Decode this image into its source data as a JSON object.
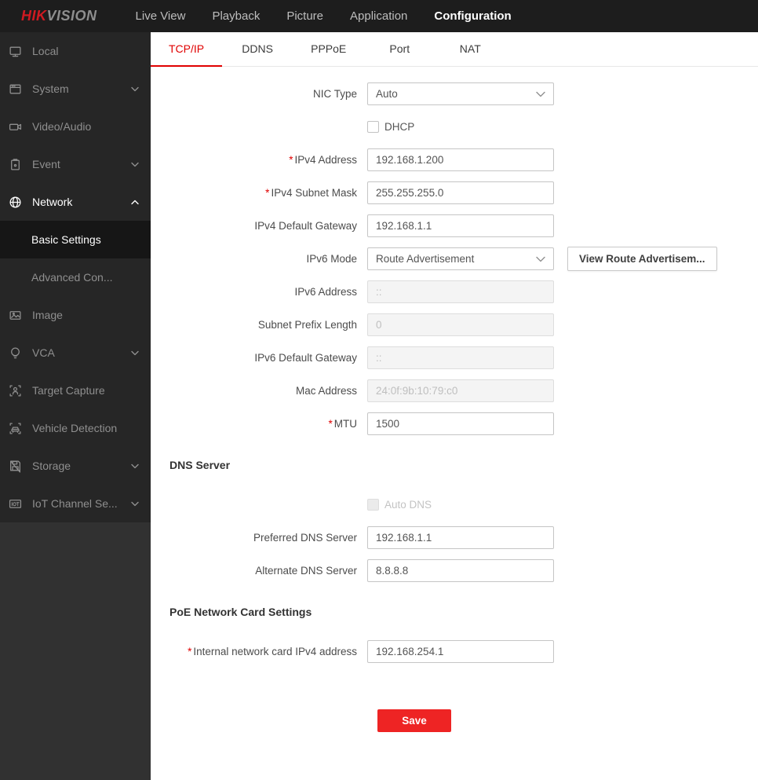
{
  "required_marker": "*",
  "topbar": {
    "logo": {
      "hik": "HIK",
      "vision": "VISION"
    },
    "nav": [
      {
        "label": "Live View"
      },
      {
        "label": "Playback"
      },
      {
        "label": "Picture"
      },
      {
        "label": "Application"
      },
      {
        "label": "Configuration"
      }
    ]
  },
  "sidebar": {
    "items": [
      {
        "label": "Local"
      },
      {
        "label": "System"
      },
      {
        "label": "Video/Audio"
      },
      {
        "label": "Event"
      },
      {
        "label": "Network"
      },
      {
        "label": "Basic Settings"
      },
      {
        "label": "Advanced Con..."
      },
      {
        "label": "Image"
      },
      {
        "label": "VCA"
      },
      {
        "label": "Target Capture"
      },
      {
        "label": "Vehicle Detection"
      },
      {
        "label": "Storage"
      },
      {
        "label": "IoT Channel Se..."
      }
    ]
  },
  "tabs": [
    {
      "label": "TCP/IP"
    },
    {
      "label": "DDNS"
    },
    {
      "label": "PPPoE"
    },
    {
      "label": "Port"
    },
    {
      "label": "NAT"
    }
  ],
  "form": {
    "nic_type": {
      "label": "NIC Type",
      "value": "Auto"
    },
    "dhcp": {
      "label": "DHCP",
      "checked": false
    },
    "ipv4_address": {
      "label": "IPv4 Address",
      "value": "192.168.1.200"
    },
    "ipv4_subnet": {
      "label": "IPv4 Subnet Mask",
      "value": "255.255.255.0"
    },
    "ipv4_gateway": {
      "label": "IPv4 Default Gateway",
      "value": "192.168.1.1"
    },
    "ipv6_mode": {
      "label": "IPv6 Mode",
      "value": "Route Advertisement",
      "button": "View Route Advertisem..."
    },
    "ipv6_address": {
      "label": "IPv6 Address",
      "value": "::"
    },
    "subnet_prefix": {
      "label": "Subnet Prefix Length",
      "value": "0"
    },
    "ipv6_gateway": {
      "label": "IPv6 Default Gateway",
      "value": "::"
    },
    "mac_address": {
      "label": "Mac Address",
      "value": "24:0f:9b:10:79:c0"
    },
    "mtu": {
      "label": "MTU",
      "value": "1500"
    }
  },
  "dns": {
    "heading": "DNS Server",
    "auto_dns": {
      "label": "Auto DNS",
      "checked": false
    },
    "preferred": {
      "label": "Preferred DNS Server",
      "value": "192.168.1.1"
    },
    "alternate": {
      "label": "Alternate DNS Server",
      "value": "8.8.8.8"
    }
  },
  "poe": {
    "heading": "PoE Network Card Settings",
    "internal_ip": {
      "label": "Internal network card IPv4 address",
      "value": "192.168.254.1"
    }
  },
  "save_label": "Save",
  "colors": {
    "accent_red": "#e00000",
    "save_red": "#ee2424",
    "topbar_bg": "#1d1d1d",
    "sidebar_bg": "#313131",
    "menu_bg": "#262626"
  }
}
